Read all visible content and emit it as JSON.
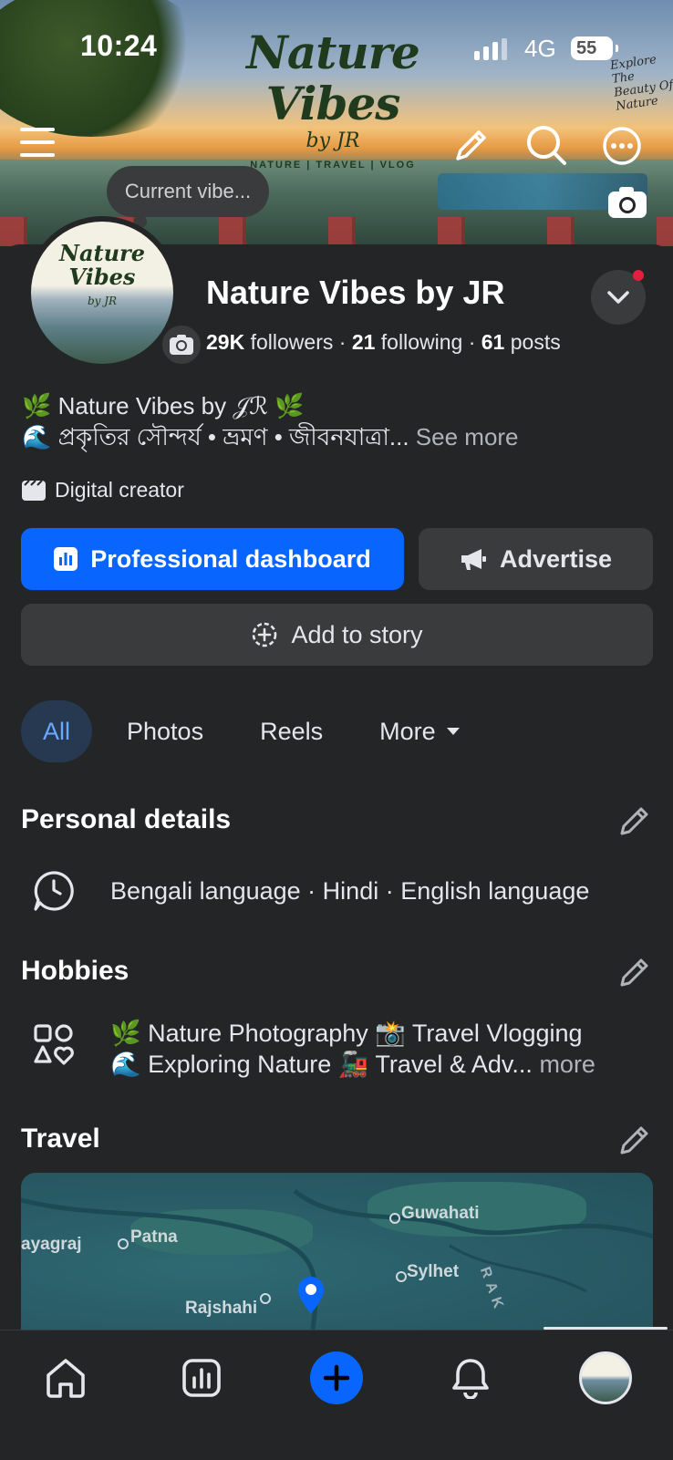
{
  "status_bar": {
    "time": "10:24",
    "network": "4G",
    "battery": "55"
  },
  "cover": {
    "logo_name": "Nature Vibes",
    "logo_by": "by JR",
    "logo_tagline": "NATURE | TRAVEL | VLOG",
    "side_text": "Explore The Beauty Of Nature"
  },
  "note_bubble": {
    "placeholder": "Current vibe..."
  },
  "avatar": {
    "mini_name": "Nature Vibes",
    "mini_by": "by JR"
  },
  "profile": {
    "name": "Nature Vibes by JR",
    "followers_count": "29K",
    "followers_label": "followers",
    "following_count": "21",
    "following_label": "following",
    "posts_count": "61",
    "posts_label": "posts",
    "sep": "·"
  },
  "bio": {
    "line1": "🌿 Nature Vibes by 𝒥ℛ 🌿",
    "line2": "🌊 প্রকৃতির সৌন্দর্য • ভ্রমণ • জীবনযাত্রা...",
    "see_more": "See more"
  },
  "category": "Digital creator",
  "buttons": {
    "dashboard": "Professional dashboard",
    "advertise": "Advertise",
    "add_story": "Add to story"
  },
  "tabs": [
    {
      "label": "All",
      "active": true
    },
    {
      "label": "Photos",
      "active": false
    },
    {
      "label": "Reels",
      "active": false
    },
    {
      "label": "More",
      "active": false
    }
  ],
  "personal_details": {
    "title": "Personal details",
    "languages": "Bengali language · Hindi · English language"
  },
  "hobbies": {
    "title": "Hobbies",
    "line1": "🌿 Nature Photography 📸 Travel Vlogging",
    "line2": "🌊 Exploring Nature 🚂 Travel & Adv...",
    "more": "more"
  },
  "travel": {
    "title": "Travel",
    "map_labels": [
      "Guwahati",
      "ayagraj",
      "Patna",
      "Sylhet",
      "Rajshahi",
      "RAK"
    ]
  },
  "colors": {
    "accent": "#0866ff",
    "background": "#242526",
    "surface": "#3a3b3c",
    "notification": "#e41e3f"
  }
}
